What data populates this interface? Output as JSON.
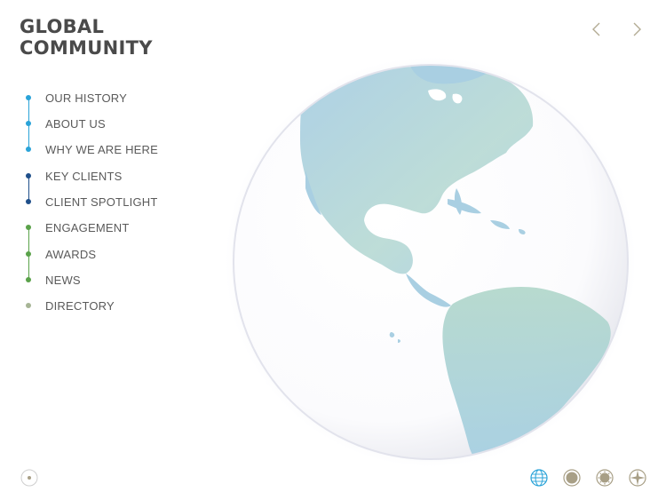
{
  "header": {
    "title_line1": "GLOBAL",
    "title_line2": "COMMUNITY"
  },
  "nav": {
    "items": [
      {
        "label": "OUR HISTORY",
        "color": "#2aa3d8"
      },
      {
        "label": "ABOUT US",
        "color": "#2aa3d8"
      },
      {
        "label": "WHY WE ARE HERE",
        "color": "#2aa3d8"
      },
      {
        "label": "KEY CLIENTS",
        "color": "#1f4f8a"
      },
      {
        "label": "CLIENT SPOTLIGHT",
        "color": "#1f4f8a"
      },
      {
        "label": "ENGAGEMENT",
        "color": "#5aa24a"
      },
      {
        "label": "AWARDS",
        "color": "#5aa24a"
      },
      {
        "label": "NEWS",
        "color": "#5aa24a"
      },
      {
        "label": "DIRECTORY",
        "color": "#a7b596"
      }
    ]
  },
  "pager": {
    "prev_icon": "chevron-left-icon",
    "next_icon": "chevron-right-icon"
  },
  "bottom_bar": {
    "icons": [
      "globe-icon",
      "circle-icon",
      "sun-icon",
      "compass-icon"
    ],
    "active_color": "#2aa3d8",
    "inactive_color": "#a89f86"
  }
}
